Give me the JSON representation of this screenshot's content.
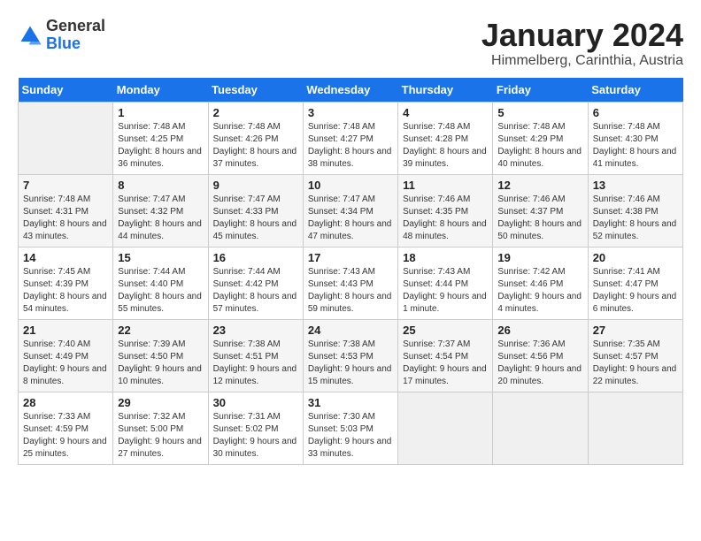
{
  "header": {
    "logo_general": "General",
    "logo_blue": "Blue",
    "month_year": "January 2024",
    "location": "Himmelberg, Carinthia, Austria"
  },
  "days_of_week": [
    "Sunday",
    "Monday",
    "Tuesday",
    "Wednesday",
    "Thursday",
    "Friday",
    "Saturday"
  ],
  "weeks": [
    [
      {
        "day": "",
        "sunrise": "",
        "sunset": "",
        "daylight": ""
      },
      {
        "day": "1",
        "sunrise": "Sunrise: 7:48 AM",
        "sunset": "Sunset: 4:25 PM",
        "daylight": "Daylight: 8 hours and 36 minutes."
      },
      {
        "day": "2",
        "sunrise": "Sunrise: 7:48 AM",
        "sunset": "Sunset: 4:26 PM",
        "daylight": "Daylight: 8 hours and 37 minutes."
      },
      {
        "day": "3",
        "sunrise": "Sunrise: 7:48 AM",
        "sunset": "Sunset: 4:27 PM",
        "daylight": "Daylight: 8 hours and 38 minutes."
      },
      {
        "day": "4",
        "sunrise": "Sunrise: 7:48 AM",
        "sunset": "Sunset: 4:28 PM",
        "daylight": "Daylight: 8 hours and 39 minutes."
      },
      {
        "day": "5",
        "sunrise": "Sunrise: 7:48 AM",
        "sunset": "Sunset: 4:29 PM",
        "daylight": "Daylight: 8 hours and 40 minutes."
      },
      {
        "day": "6",
        "sunrise": "Sunrise: 7:48 AM",
        "sunset": "Sunset: 4:30 PM",
        "daylight": "Daylight: 8 hours and 41 minutes."
      }
    ],
    [
      {
        "day": "7",
        "sunrise": "Sunrise: 7:48 AM",
        "sunset": "Sunset: 4:31 PM",
        "daylight": "Daylight: 8 hours and 43 minutes."
      },
      {
        "day": "8",
        "sunrise": "Sunrise: 7:47 AM",
        "sunset": "Sunset: 4:32 PM",
        "daylight": "Daylight: 8 hours and 44 minutes."
      },
      {
        "day": "9",
        "sunrise": "Sunrise: 7:47 AM",
        "sunset": "Sunset: 4:33 PM",
        "daylight": "Daylight: 8 hours and 45 minutes."
      },
      {
        "day": "10",
        "sunrise": "Sunrise: 7:47 AM",
        "sunset": "Sunset: 4:34 PM",
        "daylight": "Daylight: 8 hours and 47 minutes."
      },
      {
        "day": "11",
        "sunrise": "Sunrise: 7:46 AM",
        "sunset": "Sunset: 4:35 PM",
        "daylight": "Daylight: 8 hours and 48 minutes."
      },
      {
        "day": "12",
        "sunrise": "Sunrise: 7:46 AM",
        "sunset": "Sunset: 4:37 PM",
        "daylight": "Daylight: 8 hours and 50 minutes."
      },
      {
        "day": "13",
        "sunrise": "Sunrise: 7:46 AM",
        "sunset": "Sunset: 4:38 PM",
        "daylight": "Daylight: 8 hours and 52 minutes."
      }
    ],
    [
      {
        "day": "14",
        "sunrise": "Sunrise: 7:45 AM",
        "sunset": "Sunset: 4:39 PM",
        "daylight": "Daylight: 8 hours and 54 minutes."
      },
      {
        "day": "15",
        "sunrise": "Sunrise: 7:44 AM",
        "sunset": "Sunset: 4:40 PM",
        "daylight": "Daylight: 8 hours and 55 minutes."
      },
      {
        "day": "16",
        "sunrise": "Sunrise: 7:44 AM",
        "sunset": "Sunset: 4:42 PM",
        "daylight": "Daylight: 8 hours and 57 minutes."
      },
      {
        "day": "17",
        "sunrise": "Sunrise: 7:43 AM",
        "sunset": "Sunset: 4:43 PM",
        "daylight": "Daylight: 8 hours and 59 minutes."
      },
      {
        "day": "18",
        "sunrise": "Sunrise: 7:43 AM",
        "sunset": "Sunset: 4:44 PM",
        "daylight": "Daylight: 9 hours and 1 minute."
      },
      {
        "day": "19",
        "sunrise": "Sunrise: 7:42 AM",
        "sunset": "Sunset: 4:46 PM",
        "daylight": "Daylight: 9 hours and 4 minutes."
      },
      {
        "day": "20",
        "sunrise": "Sunrise: 7:41 AM",
        "sunset": "Sunset: 4:47 PM",
        "daylight": "Daylight: 9 hours and 6 minutes."
      }
    ],
    [
      {
        "day": "21",
        "sunrise": "Sunrise: 7:40 AM",
        "sunset": "Sunset: 4:49 PM",
        "daylight": "Daylight: 9 hours and 8 minutes."
      },
      {
        "day": "22",
        "sunrise": "Sunrise: 7:39 AM",
        "sunset": "Sunset: 4:50 PM",
        "daylight": "Daylight: 9 hours and 10 minutes."
      },
      {
        "day": "23",
        "sunrise": "Sunrise: 7:38 AM",
        "sunset": "Sunset: 4:51 PM",
        "daylight": "Daylight: 9 hours and 12 minutes."
      },
      {
        "day": "24",
        "sunrise": "Sunrise: 7:38 AM",
        "sunset": "Sunset: 4:53 PM",
        "daylight": "Daylight: 9 hours and 15 minutes."
      },
      {
        "day": "25",
        "sunrise": "Sunrise: 7:37 AM",
        "sunset": "Sunset: 4:54 PM",
        "daylight": "Daylight: 9 hours and 17 minutes."
      },
      {
        "day": "26",
        "sunrise": "Sunrise: 7:36 AM",
        "sunset": "Sunset: 4:56 PM",
        "daylight": "Daylight: 9 hours and 20 minutes."
      },
      {
        "day": "27",
        "sunrise": "Sunrise: 7:35 AM",
        "sunset": "Sunset: 4:57 PM",
        "daylight": "Daylight: 9 hours and 22 minutes."
      }
    ],
    [
      {
        "day": "28",
        "sunrise": "Sunrise: 7:33 AM",
        "sunset": "Sunset: 4:59 PM",
        "daylight": "Daylight: 9 hours and 25 minutes."
      },
      {
        "day": "29",
        "sunrise": "Sunrise: 7:32 AM",
        "sunset": "Sunset: 5:00 PM",
        "daylight": "Daylight: 9 hours and 27 minutes."
      },
      {
        "day": "30",
        "sunrise": "Sunrise: 7:31 AM",
        "sunset": "Sunset: 5:02 PM",
        "daylight": "Daylight: 9 hours and 30 minutes."
      },
      {
        "day": "31",
        "sunrise": "Sunrise: 7:30 AM",
        "sunset": "Sunset: 5:03 PM",
        "daylight": "Daylight: 9 hours and 33 minutes."
      },
      {
        "day": "",
        "sunrise": "",
        "sunset": "",
        "daylight": ""
      },
      {
        "day": "",
        "sunrise": "",
        "sunset": "",
        "daylight": ""
      },
      {
        "day": "",
        "sunrise": "",
        "sunset": "",
        "daylight": ""
      }
    ]
  ]
}
